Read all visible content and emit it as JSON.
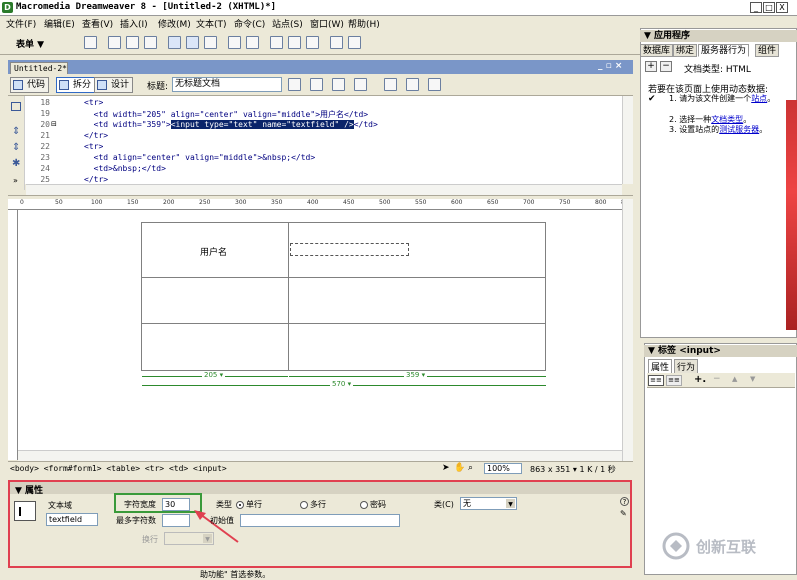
{
  "window": {
    "title": "Macromedia Dreamweaver 8 - [Untitled-2 (XHTML)*]",
    "min": "_",
    "max": "□",
    "close": "X"
  },
  "menu": [
    "文件(F)",
    "编辑(E)",
    "查看(V)",
    "插入(I)",
    "修改(M)",
    "文本(T)",
    "命令(C)",
    "站点(S)",
    "窗口(W)",
    "帮助(H)"
  ],
  "insert_bar": {
    "category": "表单 ▼"
  },
  "document": {
    "tab": "Untitled-2*",
    "views": {
      "code": "代码",
      "split": "拆分",
      "design": "设计"
    },
    "title_label": "标题:",
    "title_value": "无标题文档",
    "lines": [
      {
        "n": "18",
        "code": "<tr>"
      },
      {
        "n": "19",
        "code": "  <td width=\"205\" align=\"center\" valign=\"middle\">用户名</td>"
      },
      {
        "n": "20",
        "code": "  <td width=\"359\">",
        "sel": "<input type=\"text\" name=\"textfield\" />",
        "tail": "</td>"
      },
      {
        "n": "21",
        "code": "</tr>"
      },
      {
        "n": "22",
        "code": "<tr>"
      },
      {
        "n": "23",
        "code": "  <td align=\"center\" valign=\"middle\">&nbsp;</td>"
      },
      {
        "n": "24",
        "code": "  <td>&nbsp;</td>"
      },
      {
        "n": "25",
        "code": "</tr>"
      }
    ],
    "ruler": [
      "0",
      "50",
      "100",
      "150",
      "200",
      "250",
      "300",
      "350",
      "400",
      "450",
      "500",
      "550",
      "600",
      "650",
      "700",
      "750",
      "800",
      "850"
    ],
    "cell_label": "用户名",
    "col1_width": "205 ▾",
    "col2_width": "359 ▾",
    "table_width": "570 ▾",
    "status_path": "<body> <form#form1> <table> <tr> <td> <input>",
    "zoom": "100%",
    "dims": "863 x 351 ▾ 1 K / 1 秒"
  },
  "app_panel": {
    "header": "▼ 应用程序",
    "tabs": [
      "数据库",
      "绑定",
      "服务器行为",
      "组件"
    ],
    "doc_type": "文档类型: HTML",
    "intro": "若要在该页面上使用动态数据:",
    "steps": [
      {
        "n": "1.",
        "text": "请为该文件创建一个",
        "link": "站点",
        "end": "。"
      },
      {
        "n": "2.",
        "text": "选择一种",
        "link": "文档类型",
        "end": "。"
      },
      {
        "n": "3.",
        "text": "设置站点的",
        "link": "测试服务器",
        "end": "。"
      }
    ]
  },
  "tag_panel": {
    "header": "▼ 标签 <input>",
    "tabs": [
      "属性",
      "行为"
    ]
  },
  "properties": {
    "header": "▼ 属性",
    "type_label": "文本域",
    "name_value": "textfield",
    "char_width_label": "字符宽度",
    "char_width_value": "30",
    "max_chars_label": "最多字符数",
    "init_label": "初始值",
    "type_group_label": "类型",
    "single_line": "单行",
    "multi_line": "多行",
    "password": "密码",
    "class_label": "类(C)",
    "class_value": "无",
    "wrap_label": "换行"
  },
  "bottom_text": "助功能\" 首选参数。",
  "watermark": "创新互联"
}
